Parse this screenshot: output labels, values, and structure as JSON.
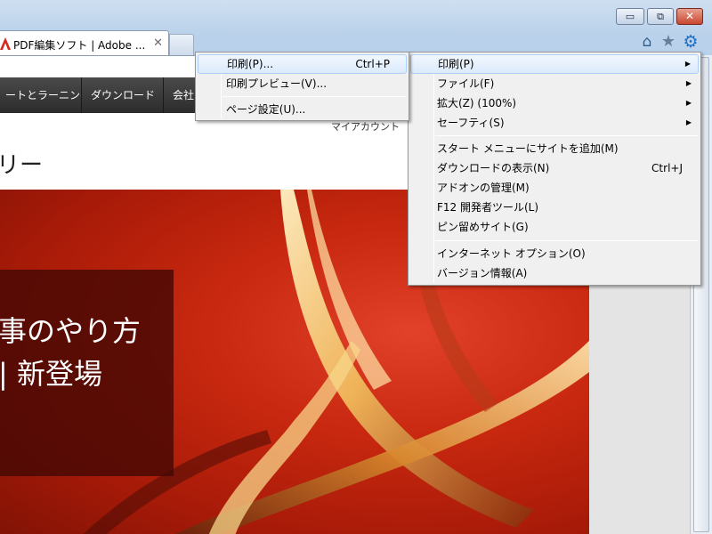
{
  "window": {
    "minimize_glyph": "▭",
    "restore_glyph": "⧉",
    "close_glyph": "✕"
  },
  "tab": {
    "title": "PDF編集ソフト | Adobe ...",
    "close_glyph": "✕"
  },
  "toolbar": {
    "home_glyph": "⌂",
    "favorites_glyph": "★",
    "tools_glyph": "⚙"
  },
  "site": {
    "nav_items": [
      "ートとラーニング",
      "ダウンロード",
      "会社"
    ],
    "my_account": "マイアカウント　フ",
    "heading": "リー",
    "hero_lines": [
      "事のやり方",
      "| 新登場"
    ]
  },
  "tools_menu": {
    "items": [
      {
        "label": "印刷(P)",
        "shortcut": "",
        "submenu": true
      },
      {
        "label": "ファイル(F)",
        "shortcut": "",
        "submenu": true
      },
      {
        "label": "拡大(Z) (100%)",
        "shortcut": "",
        "submenu": true
      },
      {
        "label": "セーフティ(S)",
        "shortcut": "",
        "submenu": true
      },
      {
        "label": "スタート メニューにサイトを追加(M)",
        "shortcut": "",
        "submenu": false
      },
      {
        "label": "ダウンロードの表示(N)",
        "shortcut": "Ctrl+J",
        "submenu": false
      },
      {
        "label": "アドオンの管理(M)",
        "shortcut": "",
        "submenu": false
      },
      {
        "label": "F12 開発者ツール(L)",
        "shortcut": "",
        "submenu": false
      },
      {
        "label": "ピン留めサイト(G)",
        "shortcut": "",
        "submenu": false
      },
      {
        "label": "インターネット オプション(O)",
        "shortcut": "",
        "submenu": false
      },
      {
        "label": "バージョン情報(A)",
        "shortcut": "",
        "submenu": false
      }
    ],
    "arrow_glyph": "▶"
  },
  "print_submenu": {
    "items": [
      {
        "label": "印刷(P)...",
        "shortcut": "Ctrl+P"
      },
      {
        "label": "印刷プレビュー(V)...",
        "shortcut": ""
      },
      {
        "label": "ページ設定(U)...",
        "shortcut": ""
      }
    ]
  }
}
